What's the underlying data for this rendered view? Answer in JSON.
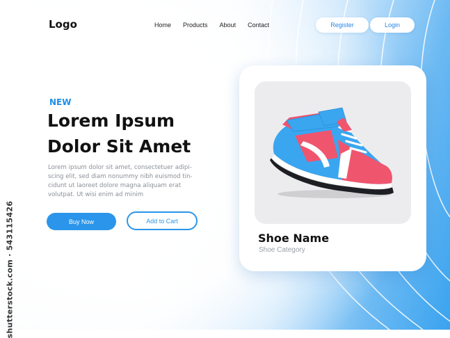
{
  "header": {
    "logo": "Logo",
    "nav": [
      "Home",
      "Products",
      "About",
      "Contact"
    ],
    "register_label": "Register",
    "login_label": "Login"
  },
  "hero": {
    "tag": "NEW",
    "headline_line1": "Lorem Ipsum",
    "headline_line2": "Dolor Sit Amet",
    "body_lines": [
      "Lorem ipsum dolor sit amet, consectetuer adipi-",
      "scing elit, sed diam nonummy nibh euismod tin-",
      "cidunt ut laoreet dolore magna aliquam erat",
      "volutpat. Ut wisi enim ad minim"
    ],
    "buy_label": "Buy Now",
    "cart_label": "Add to Cart"
  },
  "product_card": {
    "name": "Shoe Name",
    "category": "Shoe Category",
    "image_icon": "sneaker-image"
  },
  "watermark": "shutterstock.com · 543115426",
  "colors": {
    "accent": "#2a95ea",
    "tag": "#1e8fe8",
    "shoe_blue": "#3aa6f0",
    "shoe_red": "#f0556e"
  }
}
